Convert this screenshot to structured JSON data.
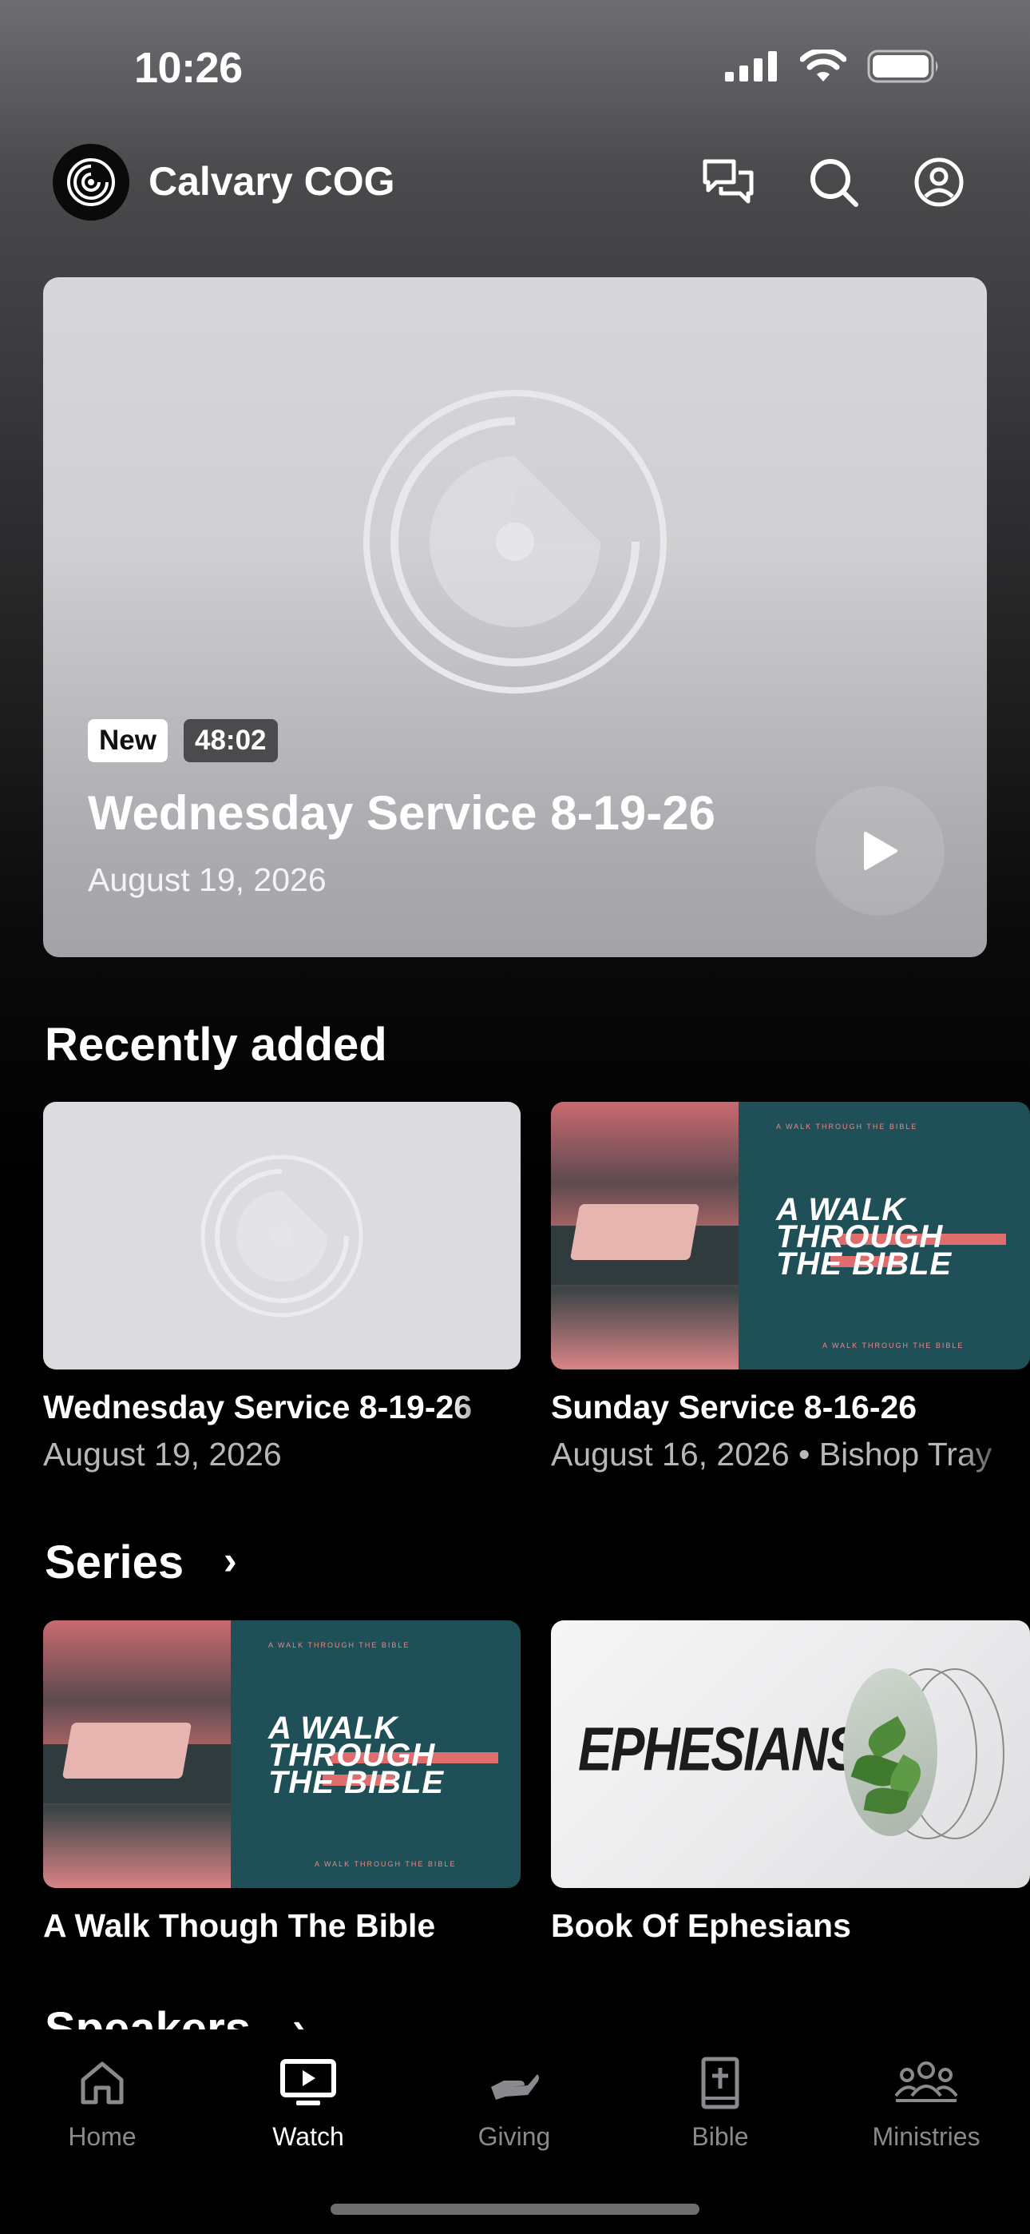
{
  "status_bar": {
    "time": "10:26"
  },
  "header": {
    "church_name": "Calvary COG"
  },
  "hero": {
    "badge_new": "New",
    "duration": "48:02",
    "title": "Wednesday Service 8-19-26",
    "date": "August 19, 2026"
  },
  "recently_added": {
    "heading": "Recently added",
    "items": [
      {
        "title": "Wednesday Service 8-19-26",
        "subtitle": "August 19, 2026"
      },
      {
        "title": "Sunday Service 8-16-26",
        "subtitle": "August 16, 2026 • Bishop Tray"
      }
    ]
  },
  "series": {
    "heading": "Series",
    "items": [
      {
        "title": "A Walk Though The Bible",
        "art_text": "A WALK THROUGH THE BIBLE",
        "art_small": "A WALK THROUGH THE BIBLE"
      },
      {
        "title": "Book Of Ephesians",
        "art_text": "EPHESIANS"
      }
    ]
  },
  "speakers": {
    "heading": "Speakers"
  },
  "tabs": [
    {
      "label": "Home",
      "icon": "home-icon"
    },
    {
      "label": "Watch",
      "icon": "tv-icon"
    },
    {
      "label": "Giving",
      "icon": "giving-hand-icon"
    },
    {
      "label": "Bible",
      "icon": "bible-icon"
    },
    {
      "label": "Ministries",
      "icon": "people-group-icon"
    }
  ],
  "active_tab": "Watch",
  "colors": {
    "accent_coral": "#e06d6e",
    "series_teal": "#1f4f57"
  }
}
